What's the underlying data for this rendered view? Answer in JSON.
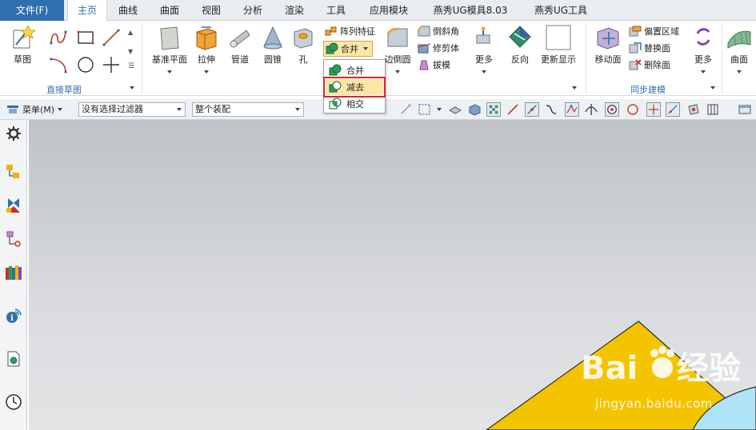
{
  "menubar": {
    "file": "文件(F)",
    "tabs": [
      "主页",
      "曲线",
      "曲面",
      "视图",
      "分析",
      "渲染",
      "工具",
      "应用模块",
      "燕秀UG模具8.03",
      "燕秀UG工具"
    ],
    "active_tab": "主页"
  },
  "ribbon": {
    "sketch": "草图",
    "group_direct_sketch": "直接草图",
    "datum_plane": "基准平面",
    "extrude": "拉伸",
    "tube": "管道",
    "cone": "圆锥",
    "hole": "孔",
    "pattern_feature": "阵列特征",
    "unite": "合并",
    "edge_blend": "边倒圆",
    "chamfer": "倒斜角",
    "trim_body": "修剪体",
    "draft": "拔模",
    "more1": "更多",
    "reverse": "反向",
    "update_display": "更新显示",
    "move_face": "移动面",
    "offset_region": "偏置区域",
    "replace_face": "替换面",
    "delete_face": "删除面",
    "group_sync": "同步建模",
    "more2": "更多",
    "surface": "曲面"
  },
  "dropdown": {
    "items": [
      "合并",
      "减去",
      "相交"
    ],
    "highlighted": "减去"
  },
  "toolbar": {
    "menu": "菜单(M)",
    "filter": "没有选择过滤器",
    "assembly": "整个装配"
  },
  "watermark": {
    "text": "jingyan.baidu.com"
  },
  "colors": {
    "accent": "#2f6fad",
    "highlight_bg": "#fbe6a6",
    "highlight_border": "#d6262c",
    "model_yellow": "#f5c400"
  }
}
